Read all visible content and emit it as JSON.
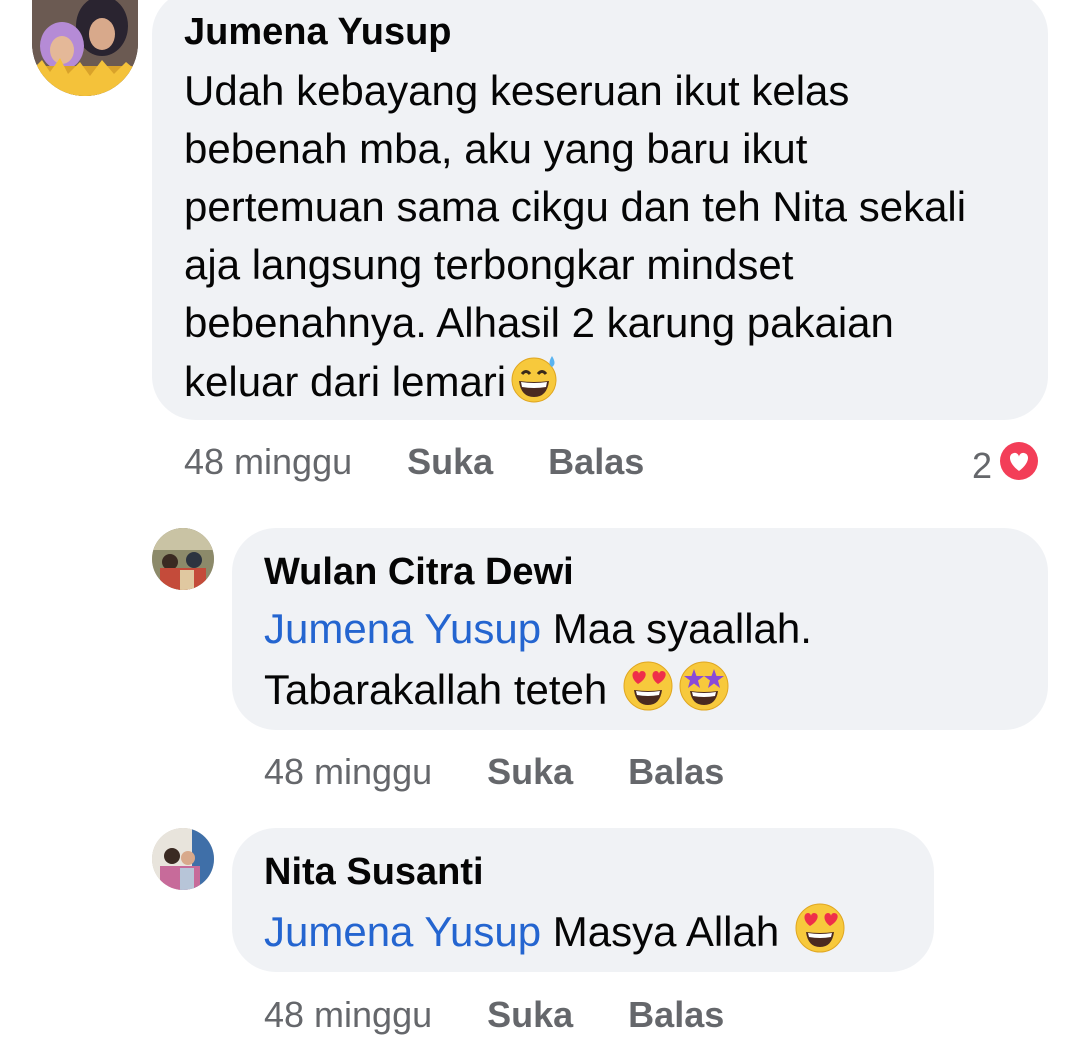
{
  "comments": [
    {
      "author": "Jumena Yusup",
      "text": "Udah kebayang keseruan ikut kelas bebenah mba, aku yang baru ikut pertemuan sama cikgu dan teh Nita sekali aja langsung terbongkar mindset bebenahnya. Alhasil 2 karung pakaian keluar dari lemari",
      "emoji": "grinning-face-with-sweat",
      "time": "48 minggu",
      "like_label": "Suka",
      "reply_label": "Balas",
      "reaction_count": "2",
      "reaction_icon": "love-reaction-icon"
    }
  ],
  "replies": [
    {
      "author": "Wulan Citra Dewi",
      "mention": "Jumena Yusup",
      "text": "Maa syaallah. Tabarakallah teteh",
      "emojis": [
        "heart-eyes-emoji",
        "star-struck-emoji"
      ],
      "time": "48 minggu",
      "like_label": "Suka",
      "reply_label": "Balas"
    },
    {
      "author": "Nita Susanti",
      "mention": "Jumena Yusup",
      "text": "Masya Allah",
      "emojis": [
        "heart-eyes-emoji"
      ],
      "time": "48 minggu",
      "like_label": "Suka",
      "reply_label": "Balas"
    }
  ],
  "colors": {
    "bubble": "#f0f2f5",
    "mention": "#2465d0",
    "meta": "#65676b",
    "love": "#f33e58"
  }
}
